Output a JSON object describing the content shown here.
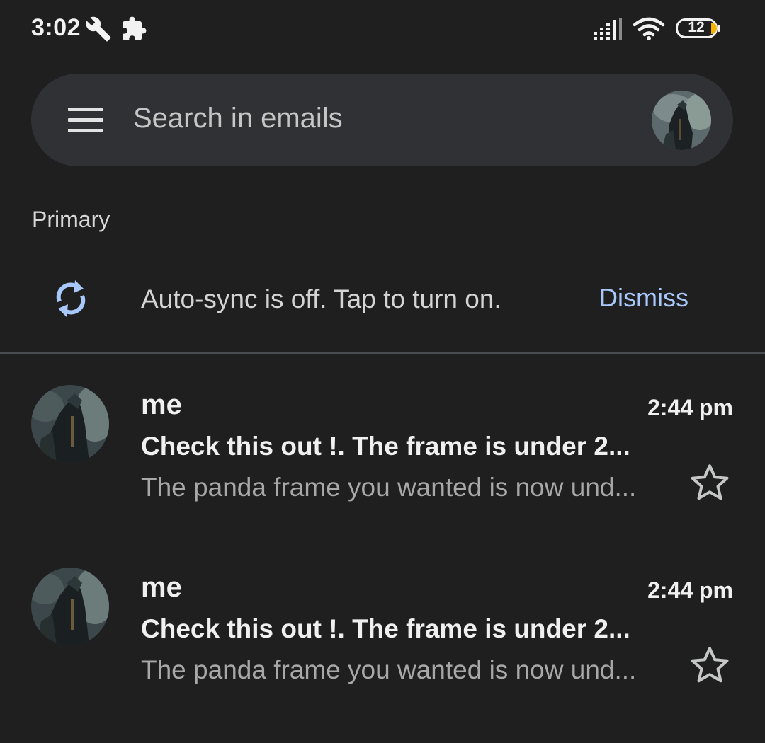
{
  "status_bar": {
    "time": "3:02",
    "battery_level": "12",
    "icons": [
      "wrench-icon",
      "puzzle-icon",
      "signal-icon",
      "wifi-icon",
      "battery-icon"
    ]
  },
  "search": {
    "placeholder": "Search in emails",
    "menu_icon": "hamburger-menu-icon",
    "account_icon": "account-avatar"
  },
  "section": {
    "label": "Primary"
  },
  "sync_banner": {
    "icon": "sync-icon",
    "message": "Auto-sync is off. Tap to turn on.",
    "dismiss_label": "Dismiss"
  },
  "emails": [
    {
      "sender": "me",
      "time": "2:44 pm",
      "subject": "Check this out !. The frame is under 2...",
      "snippet": "The panda frame you wanted is now und...",
      "starred": false
    },
    {
      "sender": "me",
      "time": "2:44 pm",
      "subject": "Check this out !. The frame is under 2...",
      "snippet": "The panda frame you wanted is now und...",
      "starred": false
    }
  ],
  "colors": {
    "background": "#1f1f1f",
    "search_bar": "#303134",
    "accent": "#a8c7fa",
    "primary_text": "#f0f0f0",
    "secondary_text": "#a8a8a8",
    "battery_low": "#f4b400"
  }
}
